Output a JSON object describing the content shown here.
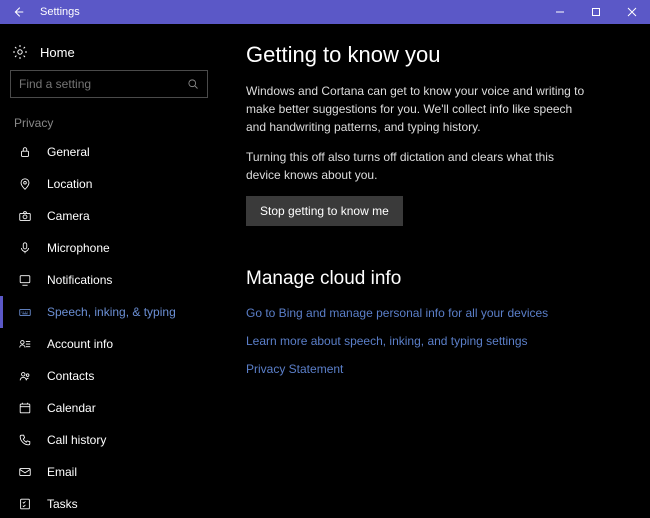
{
  "titlebar": {
    "title": "Settings"
  },
  "sidebar": {
    "home": "Home",
    "search_placeholder": "Find a setting",
    "section": "Privacy",
    "items": [
      {
        "label": "General"
      },
      {
        "label": "Location"
      },
      {
        "label": "Camera"
      },
      {
        "label": "Microphone"
      },
      {
        "label": "Notifications"
      },
      {
        "label": "Speech, inking, & typing"
      },
      {
        "label": "Account info"
      },
      {
        "label": "Contacts"
      },
      {
        "label": "Calendar"
      },
      {
        "label": "Call history"
      },
      {
        "label": "Email"
      },
      {
        "label": "Tasks"
      }
    ]
  },
  "content": {
    "heading1": "Getting to know you",
    "para1": "Windows and Cortana can get to know your voice and writing to make better suggestions for you. We'll collect info like speech and handwriting patterns, and typing history.",
    "para2": "Turning this off also turns off dictation and clears what this device knows about you.",
    "button": "Stop getting to know me",
    "heading2": "Manage cloud info",
    "link1": "Go to Bing and manage personal info for all your devices",
    "link2": "Learn more about speech, inking, and typing settings",
    "link3": "Privacy Statement"
  }
}
